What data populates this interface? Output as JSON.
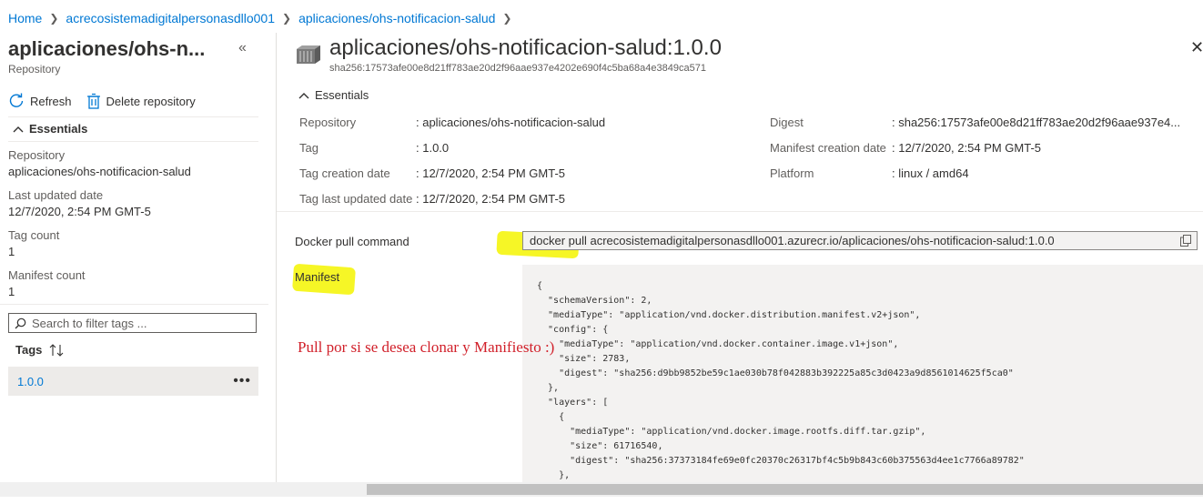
{
  "breadcrumb": [
    "Home",
    "acrecosistemadigitalpersonasdllo001",
    "aplicaciones/ohs-notificacion-salud"
  ],
  "left": {
    "title": "aplicaciones/ohs-n...",
    "subtitle": "Repository",
    "refresh": "Refresh",
    "delete": "Delete repository",
    "essentials": "Essentials",
    "props": [
      {
        "label": "Repository",
        "value": "aplicaciones/ohs-notificacion-salud"
      },
      {
        "label": "Last updated date",
        "value": "12/7/2020, 2:54 PM GMT-5"
      },
      {
        "label": "Tag count",
        "value": "1"
      },
      {
        "label": "Manifest count",
        "value": "1"
      }
    ],
    "search_placeholder": "Search to filter tags ...",
    "tags_header": "Tags",
    "tags": [
      "1.0.0"
    ]
  },
  "right": {
    "title": "aplicaciones/ohs-notificacion-salud:1.0.0",
    "digest": "sha256:17573afe00e8d21ff783ae20d2f96aae937e4202e690f4c5ba68a4e3849ca571",
    "essentials": "Essentials",
    "left_props": [
      {
        "label": "Repository",
        "value": ": aplicaciones/ohs-notificacion-salud"
      },
      {
        "label": "Tag",
        "value": ": 1.0.0"
      },
      {
        "label": "Tag creation date",
        "value": ": 12/7/2020, 2:54 PM GMT-5"
      },
      {
        "label": "Tag last updated date",
        "value": ": 12/7/2020, 2:54 PM GMT-5"
      }
    ],
    "right_props": [
      {
        "label": "Digest",
        "value": ": sha256:17573afe00e8d21ff783ae20d2f96aae937e4..."
      },
      {
        "label": "Manifest creation date",
        "value": ": 12/7/2020, 2:54 PM GMT-5"
      },
      {
        "label": "Platform",
        "value": ": linux / amd64"
      }
    ],
    "pull_label": "Docker pull command",
    "pull_command": "docker pull acrecosistemadigitalpersonasdllo001.azurecr.io/aplicaciones/ohs-notificacion-salud:1.0.0",
    "manifest_label": "Manifest",
    "manifest_text": "{\n  \"schemaVersion\": 2,\n  \"mediaType\": \"application/vnd.docker.distribution.manifest.v2+json\",\n  \"config\": {\n    \"mediaType\": \"application/vnd.docker.container.image.v1+json\",\n    \"size\": 2783,\n    \"digest\": \"sha256:d9bb9852be59c1ae030b78f042883b392225a85c3d0423a9d8561014625f5ca0\"\n  },\n  \"layers\": [\n    {\n      \"mediaType\": \"application/vnd.docker.image.rootfs.diff.tar.gzip\",\n      \"size\": 61716540,\n      \"digest\": \"sha256:37373184fe69e0fc20370c26317bf4c5b9b843c60b375563d4ee1c7766a89782\"\n    },",
    "annotation": "Pull por si se desea clonar y Manifiesto :)"
  },
  "colors": {
    "accent": "#0078d4",
    "highlight": "#f5f500",
    "annotation": "#d1202a"
  }
}
